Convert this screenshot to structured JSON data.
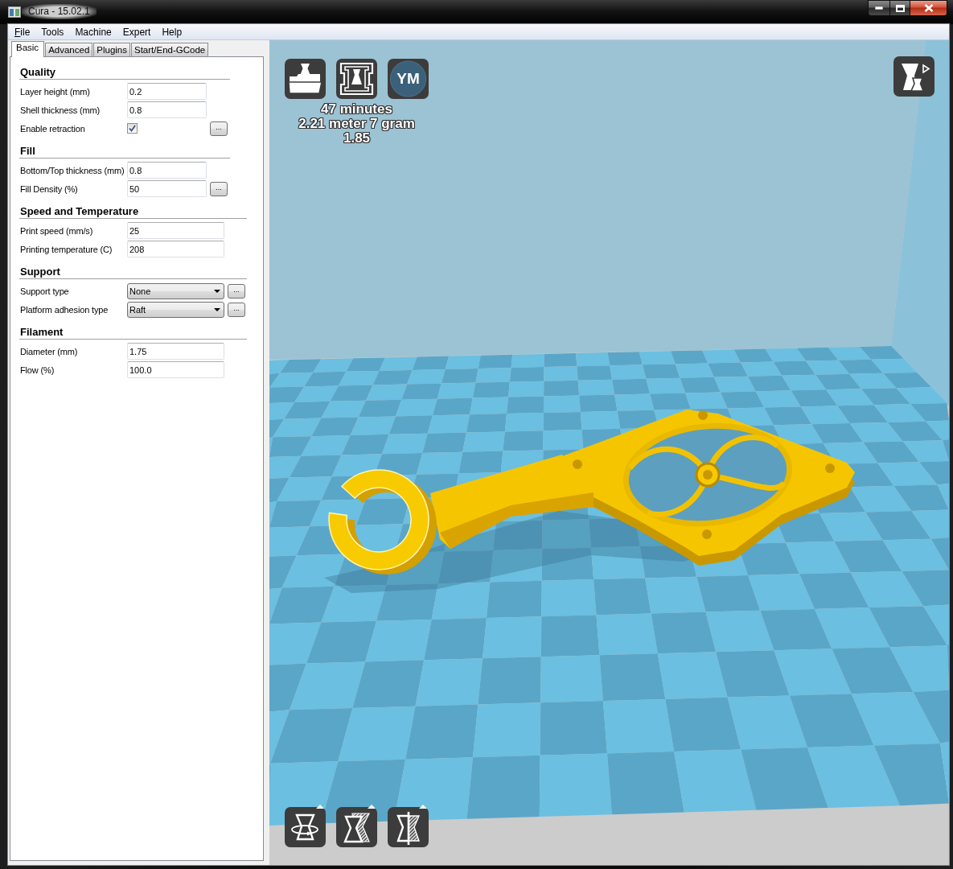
{
  "window": {
    "title": "Cura - 15.02.1"
  },
  "menu": [
    {
      "label": "File",
      "mnemonic": true
    },
    {
      "label": "Tools",
      "mnemonic": false
    },
    {
      "label": "Machine",
      "mnemonic": false
    },
    {
      "label": "Expert",
      "mnemonic": false
    },
    {
      "label": "Help",
      "mnemonic": false
    }
  ],
  "tabs": [
    {
      "label": "Basic",
      "selected": true
    },
    {
      "label": "Advanced",
      "selected": false
    },
    {
      "label": "Plugins",
      "selected": false
    },
    {
      "label": "Start/End-GCode",
      "selected": false
    }
  ],
  "sections": [
    {
      "title": "Quality",
      "rows": [
        {
          "kind": "text",
          "label": "Layer height (mm)",
          "value": "0.2"
        },
        {
          "kind": "text",
          "label": "Shell thickness (mm)",
          "value": "0.8"
        },
        {
          "kind": "checkbox",
          "label": "Enable retraction",
          "checked": true,
          "button": "..."
        }
      ]
    },
    {
      "title": "Fill",
      "rows": [
        {
          "kind": "text",
          "label": "Bottom/Top thickness (mm)",
          "value": "0.8"
        },
        {
          "kind": "text",
          "label": "Fill Density (%)",
          "value": "50",
          "button": "..."
        }
      ]
    },
    {
      "title": "Speed and Temperature",
      "rows": [
        {
          "kind": "text",
          "label": "Print speed (mm/s)",
          "value": "25"
        },
        {
          "kind": "text",
          "label": "Printing temperature (C)",
          "value": "208"
        }
      ]
    },
    {
      "title": "Support",
      "rows": [
        {
          "kind": "select",
          "label": "Support type",
          "value": "None",
          "button": "..."
        },
        {
          "kind": "select",
          "label": "Platform adhesion type",
          "value": "Raft",
          "button": "..."
        }
      ]
    },
    {
      "title": "Filament",
      "rows": [
        {
          "kind": "text",
          "label": "Diameter (mm)",
          "value": "1.75"
        },
        {
          "kind": "text",
          "label": "Flow (%)",
          "value": "100.0"
        }
      ]
    }
  ],
  "viewport": {
    "share_label": "YM",
    "stats": [
      "47 minutes",
      "2.21 meter 7 gram",
      "1.85"
    ]
  }
}
